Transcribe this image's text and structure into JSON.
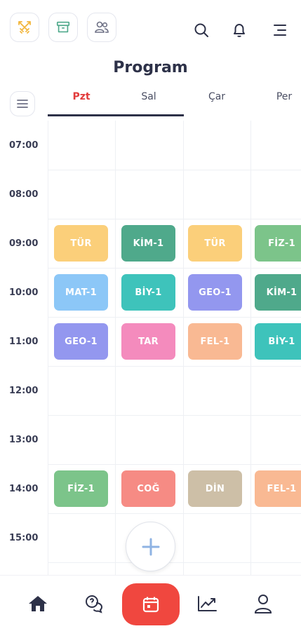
{
  "header": {
    "title": "Program",
    "icons": [
      "sword-icon",
      "archive-icon",
      "users-icon",
      "search-icon",
      "bell-icon",
      "menu-icon"
    ]
  },
  "days": [
    {
      "label": "Pzt",
      "active": true
    },
    {
      "label": "Sal",
      "active": false
    },
    {
      "label": "Çar",
      "active": false
    },
    {
      "label": "Per",
      "active": false
    }
  ],
  "times": [
    "07:00",
    "08:00",
    "09:00",
    "10:00",
    "11:00",
    "12:00",
    "13:00",
    "14:00",
    "15:00"
  ],
  "lessons": [
    {
      "day": 0,
      "hour": "09:00",
      "label": "TÜR",
      "color": "#fbcf7a"
    },
    {
      "day": 1,
      "hour": "09:00",
      "label": "KİM-1",
      "color": "#4fa98b"
    },
    {
      "day": 2,
      "hour": "09:00",
      "label": "TÜR",
      "color": "#fbcf7a"
    },
    {
      "day": 3,
      "hour": "09:00",
      "label": "FİZ-1",
      "color": "#7cc48a"
    },
    {
      "day": 0,
      "hour": "10:00",
      "label": "MAT-1",
      "color": "#8cc7f7"
    },
    {
      "day": 1,
      "hour": "10:00",
      "label": "BİY-1",
      "color": "#3ec3bb"
    },
    {
      "day": 2,
      "hour": "10:00",
      "label": "GEO-1",
      "color": "#9397ef"
    },
    {
      "day": 3,
      "hour": "10:00",
      "label": "KİM-1",
      "color": "#4fa98b"
    },
    {
      "day": 0,
      "hour": "11:00",
      "label": "GEO-1",
      "color": "#9397ef"
    },
    {
      "day": 1,
      "hour": "11:00",
      "label": "TAR",
      "color": "#f48bbd"
    },
    {
      "day": 2,
      "hour": "11:00",
      "label": "FEL-1",
      "color": "#f9b993"
    },
    {
      "day": 3,
      "hour": "11:00",
      "label": "BİY-1",
      "color": "#3ec3bb"
    },
    {
      "day": 0,
      "hour": "14:00",
      "label": "FİZ-1",
      "color": "#7cc48a"
    },
    {
      "day": 1,
      "hour": "14:00",
      "label": "COĞ",
      "color": "#f68b84"
    },
    {
      "day": 2,
      "hour": "14:00",
      "label": "DİN",
      "color": "#cdbfa7"
    },
    {
      "day": 3,
      "hour": "14:00",
      "label": "FEL-1",
      "color": "#f9b993"
    }
  ],
  "fab": {
    "label": "+"
  },
  "colors": {
    "accent": "#f0473f",
    "active_day": "#e23b3b",
    "text": "#2d3148"
  },
  "bottom_nav": [
    "home-icon",
    "help-chat-icon",
    "calendar-icon",
    "chart-icon",
    "profile-icon"
  ]
}
